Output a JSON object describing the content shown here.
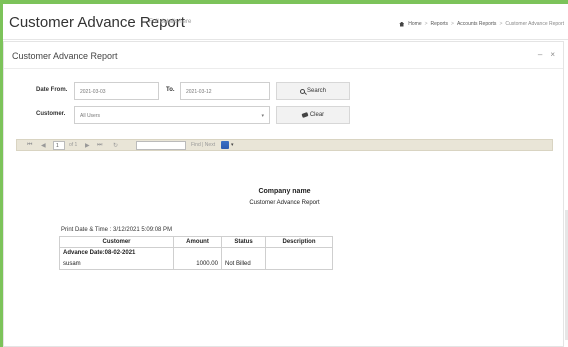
{
  "header": {
    "title": "Customer Advance Report",
    "subtitle": "Full details here",
    "breadcrumb": [
      "Home",
      "Reports",
      "Accounts Reports",
      "Customer Advance Report"
    ]
  },
  "panel": {
    "title": "Customer Advance Report",
    "tools": [
      "–",
      "×"
    ]
  },
  "form": {
    "date_from_label": "Date From.",
    "date_from_value": "2021-03-03",
    "to_label": "To.",
    "to_value": "2021-03-12",
    "search_label": "Search",
    "customer_label": "Customer.",
    "customer_value": "All Users",
    "clear_label": "Clear"
  },
  "toolbar": {
    "first": "⏮",
    "prev": "◀",
    "page_value": "1",
    "of_pages": "of 1",
    "next": "▶",
    "last": "⏭",
    "refresh": "↻",
    "find_next": "Find | Next"
  },
  "report": {
    "company": "Company name",
    "title": "Customer Advance  Report",
    "print_date": "Print Date & Time : 3/12/2021 5:09:08 PM",
    "columns": [
      "Customer",
      "Amount",
      "Status",
      "Description"
    ],
    "group_label": "Advance Date:08-02-2021",
    "rows": [
      {
        "customer": "susam",
        "amount": "1000.00",
        "status": "Not Billed",
        "description": ""
      }
    ]
  },
  "colors": {
    "accent": "#7cc35a",
    "toolbar_bg": "#e9e5d7"
  }
}
